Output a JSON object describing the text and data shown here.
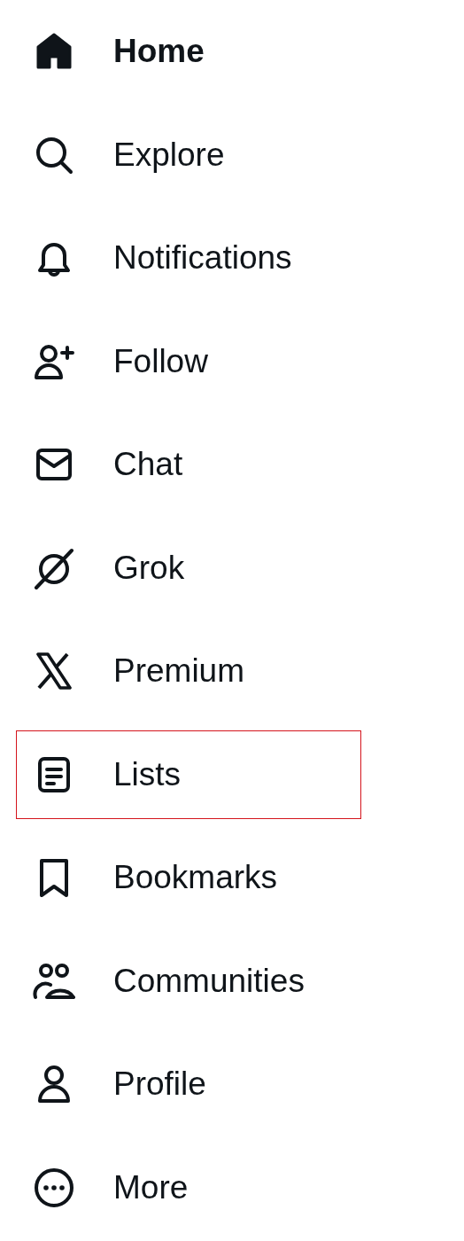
{
  "nav": {
    "items": [
      {
        "label": "Home",
        "selected": true,
        "highlighted": false
      },
      {
        "label": "Explore",
        "selected": false,
        "highlighted": false
      },
      {
        "label": "Notifications",
        "selected": false,
        "highlighted": false
      },
      {
        "label": "Follow",
        "selected": false,
        "highlighted": false
      },
      {
        "label": "Chat",
        "selected": false,
        "highlighted": false
      },
      {
        "label": "Grok",
        "selected": false,
        "highlighted": false
      },
      {
        "label": "Premium",
        "selected": false,
        "highlighted": false
      },
      {
        "label": "Lists",
        "selected": false,
        "highlighted": true
      },
      {
        "label": "Bookmarks",
        "selected": false,
        "highlighted": false
      },
      {
        "label": "Communities",
        "selected": false,
        "highlighted": false
      },
      {
        "label": "Profile",
        "selected": false,
        "highlighted": false
      },
      {
        "label": "More",
        "selected": false,
        "highlighted": false
      }
    ]
  }
}
